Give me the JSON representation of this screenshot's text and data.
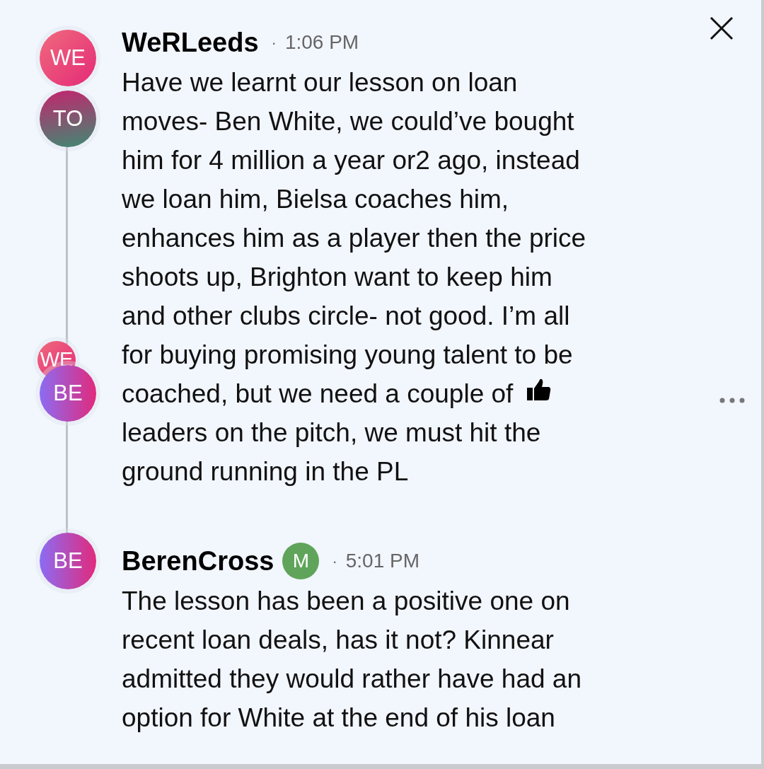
{
  "messages": [
    {
      "author": "WeRLeeds",
      "separator": "·",
      "time": "1:06 PM",
      "thread_avatars": [
        {
          "initials": "WE",
          "kind": "full"
        },
        {
          "initials": "TO",
          "kind": "full"
        },
        {
          "initials": "WE",
          "kind": "mini"
        },
        {
          "initials": "BE",
          "kind": "full"
        }
      ],
      "lines": [
        "Have we learnt our lesson on loan",
        "moves- Ben White, we could’ve bought",
        "him for 4 million a year or2 ago, instead",
        "we loan him, Bielsa coaches him,",
        "enhances him as a player then the price",
        "shoots up, Brighton want to keep him",
        "and other clubs circle- not good. I’m all",
        "for buying promising young talent to be",
        {
          "text": "coached, but we need a couple of",
          "reaction": true
        },
        "leaders on the pitch, we must hit the",
        "ground running in the PL"
      ]
    },
    {
      "author": "BerenCross",
      "badge": "M",
      "separator": "·",
      "time": "5:01 PM",
      "thread_avatars": [
        {
          "initials": "BE",
          "kind": "full"
        }
      ],
      "lines": [
        "The lesson has been a positive one on",
        "recent loan deals, has it not? Kinnear",
        "admitted they would rather have had an",
        "option for White at the end of his loan"
      ]
    }
  ]
}
